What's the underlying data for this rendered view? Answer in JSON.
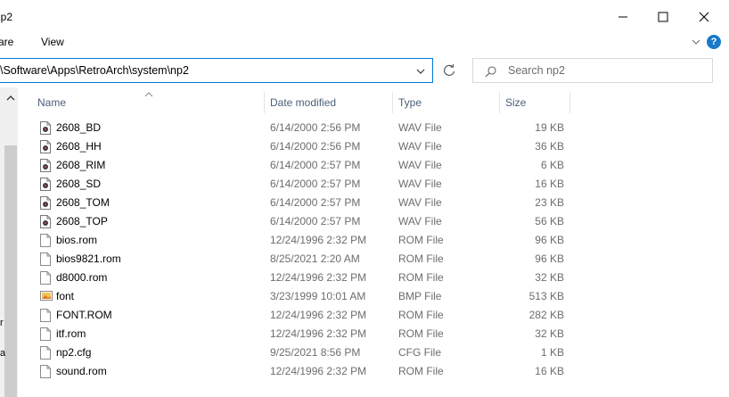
{
  "window": {
    "title": "np2"
  },
  "menu": {
    "share": "are",
    "view": "View"
  },
  "address": {
    "path": "\\Software\\Apps\\RetroArch\\system\\np2"
  },
  "search": {
    "placeholder": "Search np2"
  },
  "columns": {
    "name": "Name",
    "date": "Date modified",
    "type": "Type",
    "size": "Size"
  },
  "nav_fragments": [
    "r",
    "a"
  ],
  "files": [
    {
      "name": "2608_BD",
      "date": "6/14/2000 2:56 PM",
      "type": "WAV File",
      "size": "19 KB",
      "icon": "audio-file-icon"
    },
    {
      "name": "2608_HH",
      "date": "6/14/2000 2:56 PM",
      "type": "WAV File",
      "size": "36 KB",
      "icon": "audio-file-icon"
    },
    {
      "name": "2608_RIM",
      "date": "6/14/2000 2:57 PM",
      "type": "WAV File",
      "size": "6 KB",
      "icon": "audio-file-icon"
    },
    {
      "name": "2608_SD",
      "date": "6/14/2000 2:57 PM",
      "type": "WAV File",
      "size": "16 KB",
      "icon": "audio-file-icon"
    },
    {
      "name": "2608_TOM",
      "date": "6/14/2000 2:57 PM",
      "type": "WAV File",
      "size": "23 KB",
      "icon": "audio-file-icon"
    },
    {
      "name": "2608_TOP",
      "date": "6/14/2000 2:57 PM",
      "type": "WAV File",
      "size": "56 KB",
      "icon": "audio-file-icon"
    },
    {
      "name": "bios.rom",
      "date": "12/24/1996 2:32 PM",
      "type": "ROM File",
      "size": "96 KB",
      "icon": "blank-file-icon"
    },
    {
      "name": "bios9821.rom",
      "date": "8/25/2021 2:20 AM",
      "type": "ROM File",
      "size": "96 KB",
      "icon": "blank-file-icon"
    },
    {
      "name": "d8000.rom",
      "date": "12/24/1996 2:32 PM",
      "type": "ROM File",
      "size": "32 KB",
      "icon": "blank-file-icon"
    },
    {
      "name": "font",
      "date": "3/23/1999 10:01 AM",
      "type": "BMP File",
      "size": "513 KB",
      "icon": "image-file-icon"
    },
    {
      "name": "FONT.ROM",
      "date": "12/24/1996 2:32 PM",
      "type": "ROM File",
      "size": "282 KB",
      "icon": "blank-file-icon"
    },
    {
      "name": "itf.rom",
      "date": "12/24/1996 2:32 PM",
      "type": "ROM File",
      "size": "32 KB",
      "icon": "blank-file-icon"
    },
    {
      "name": "np2.cfg",
      "date": "9/25/2021 8:56 PM",
      "type": "CFG File",
      "size": "1 KB",
      "icon": "blank-file-icon"
    },
    {
      "name": "sound.rom",
      "date": "12/24/1996 2:32 PM",
      "type": "ROM File",
      "size": "16 KB",
      "icon": "blank-file-icon"
    }
  ]
}
